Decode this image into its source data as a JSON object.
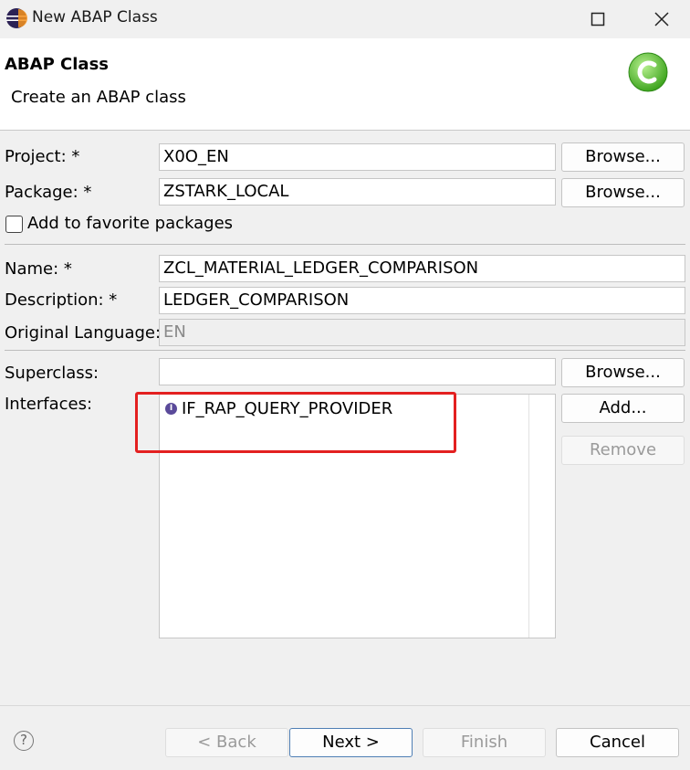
{
  "window": {
    "title": "New ABAP Class"
  },
  "header": {
    "title": "ABAP Class",
    "subtitle": "Create an ABAP class"
  },
  "form": {
    "project": {
      "label": "Project: *",
      "value": "X0O_EN",
      "browse_label": "Browse..."
    },
    "package": {
      "label": "Package: *",
      "value": "ZSTARK_LOCAL",
      "browse_label": "Browse..."
    },
    "favorite": {
      "label": "Add to favorite packages",
      "checked": false
    },
    "name": {
      "label": "Name: *",
      "value": "ZCL_MATERIAL_LEDGER_COMPARISON"
    },
    "description": {
      "label": "Description: *",
      "value": "LEDGER_COMPARISON"
    },
    "original_language": {
      "label": "Original Language:",
      "value": "EN"
    },
    "superclass": {
      "label": "Superclass:",
      "value": "",
      "browse_label": "Browse..."
    },
    "interfaces": {
      "label": "Interfaces:",
      "items": [
        "IF_RAP_QUERY_PROVIDER"
      ],
      "add_label": "Add...",
      "remove_label": "Remove"
    }
  },
  "footer": {
    "help": "?",
    "back_label": "< Back",
    "next_label": "Next >",
    "finish_label": "Finish",
    "cancel_label": "Cancel"
  },
  "colors": {
    "highlight": "#e32020",
    "class_icon": "#5cc23a"
  }
}
